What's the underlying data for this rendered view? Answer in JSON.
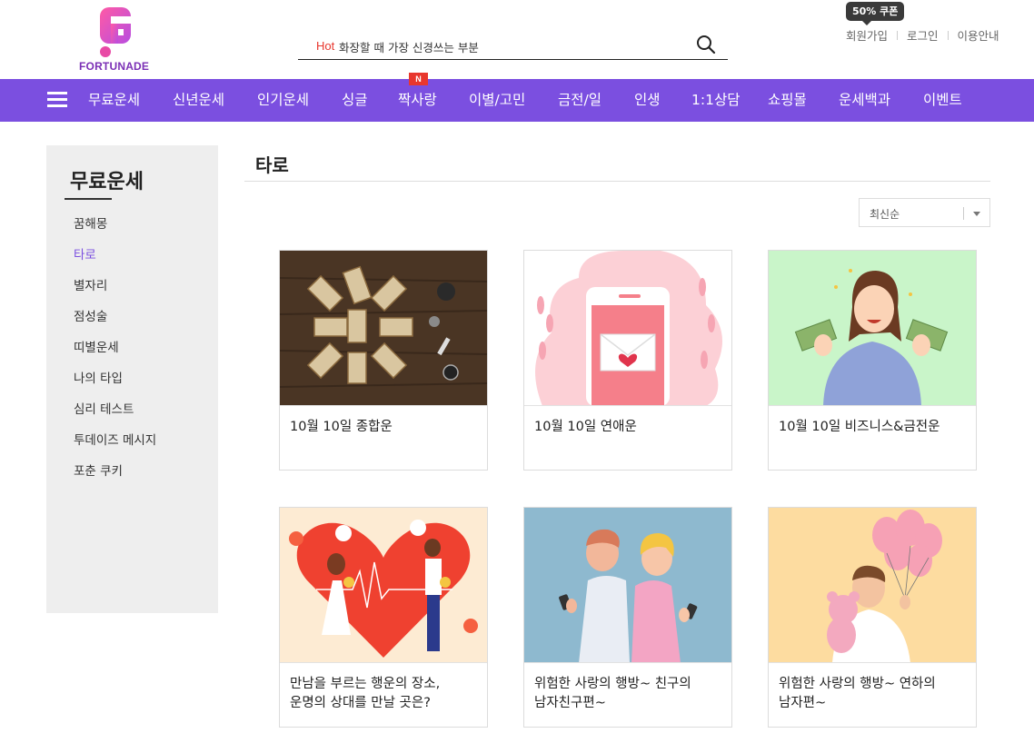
{
  "brand": {
    "name": "FORTUNADE",
    "logo_letter": "F",
    "accent": "#7b4fe0",
    "logo_gradient": [
      "#ff4fa0",
      "#b040e0"
    ]
  },
  "search": {
    "hot_label": "Hot",
    "value": "화장할 때 가장 신경쓰는 부분",
    "icon": "search-icon"
  },
  "utility": {
    "coupon_badge": "50% 쿠폰",
    "signup": "회원가입",
    "login": "로그인",
    "guide": "이용안내"
  },
  "nav": {
    "menu_icon": "hamburger-icon",
    "new_badge": "N",
    "items": [
      "무료운세",
      "신년운세",
      "인기운세",
      "싱글",
      "짝사랑",
      "이별/고민",
      "금전/일",
      "인생",
      "1:1상담",
      "쇼핑몰",
      "운세백과",
      "이벤트"
    ]
  },
  "sidebar": {
    "title": "무료운세",
    "items": [
      {
        "label": "꿈해몽",
        "active": false
      },
      {
        "label": "타로",
        "active": true
      },
      {
        "label": "별자리",
        "active": false
      },
      {
        "label": "점성술",
        "active": false
      },
      {
        "label": "띠별운세",
        "active": false
      },
      {
        "label": "나의 타입",
        "active": false
      },
      {
        "label": "심리 테스트",
        "active": false
      },
      {
        "label": "투데이즈 메시지",
        "active": false
      },
      {
        "label": "포춘 쿠키",
        "active": false
      }
    ]
  },
  "main": {
    "title": "타로",
    "sort": {
      "selected": "최신순"
    },
    "cards": [
      {
        "title": "10월 10일 종합운",
        "image": "tarot-cards-on-table"
      },
      {
        "title": "10월 10일 연애운",
        "image": "phone-love-letter"
      },
      {
        "title": "10월 10일 비즈니스&금전운",
        "image": "woman-holding-money"
      },
      {
        "title": "만남을 부르는 행운의 장소,\n운명의 상대를 만날 곳은?",
        "image": "couple-heart"
      },
      {
        "title": "위험한 사랑의 행방~ 친구의\n남자친구편~",
        "image": "couple-back-to-back-phones"
      },
      {
        "title": "위험한 사랑의 행방~ 연하의\n남자편~",
        "image": "man-with-balloons-teddy"
      }
    ]
  }
}
